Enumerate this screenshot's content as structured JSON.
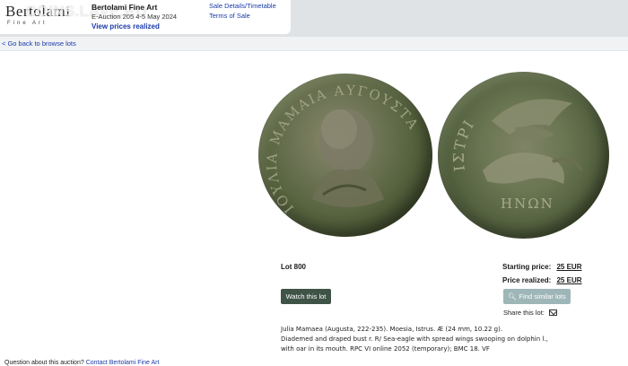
{
  "header": {
    "logo_main": "Bertolami",
    "logo_sub": "Fine Art",
    "watermark": "COINS.LAVE.RU",
    "auction_name": "Bertolami Fine Art",
    "auction_date": "E-Auction 205  4-5 May 2024",
    "view_prices": "View prices realized",
    "sale_details": "Sale Details/Timetable",
    "terms": "Terms of Sale"
  },
  "nav": {
    "back_link": "< Go back to browse lots"
  },
  "coin": {
    "obverse_legend": "ΙΟΥΛΙΑ ΜΑΜΑΙΑ ΑΥΓΟΥΣΤΑ",
    "reverse_legend_top": "ΙΣΤΡΙ",
    "reverse_legend_bottom": "ΗΝΩΝ"
  },
  "lot": {
    "label": "Lot 800",
    "starting_price_label": "Starting price:",
    "starting_price": "25 EUR",
    "price_realized_label": "Price realized:",
    "price_realized": "25 EUR",
    "watch_button": "Watch this lot",
    "find_similar_button": "Find similar lots",
    "share_label": "Share this lot:",
    "description": [
      "Julia Mamaea (Augusta, 222-235). Moesia, Istrus. Æ (24 mm, 10.22 g).",
      "Diademed and draped bust r. R/ Sea-eagle with spread wings swooping on dolphin l.,",
      "with oar in its mouth. RPC VI online 2052 (temporary); BMC 18. VF"
    ]
  },
  "footer": {
    "question": "Question about this auction?",
    "contact_link": "Contact Bertolami Fine Art"
  },
  "colors": {
    "link": "#1a3aa8",
    "watch_button_bg": "#3f5346",
    "find_button_bg": "#9fb6b8"
  }
}
